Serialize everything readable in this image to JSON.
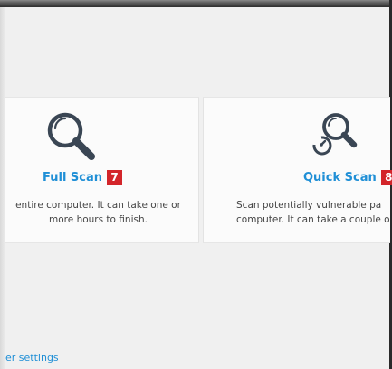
{
  "full_scan": {
    "title": "Full Scan",
    "badge": "7",
    "desc_line1": "entire computer. It can take one or",
    "desc_line2": "more hours to finish.",
    "icon": "magnifier-icon"
  },
  "quick_scan": {
    "title": "Quick Scan",
    "badge": "8",
    "desc_line1": "Scan potentially vulnerable pa",
    "desc_line2": "computer. It can take a couple o",
    "icon": "quick-magnifier-icon"
  },
  "footer": {
    "settings_link": "er settings"
  },
  "colors": {
    "accent": "#1f8fd6",
    "badge": "#d3252a",
    "icon": "#3a4654"
  }
}
